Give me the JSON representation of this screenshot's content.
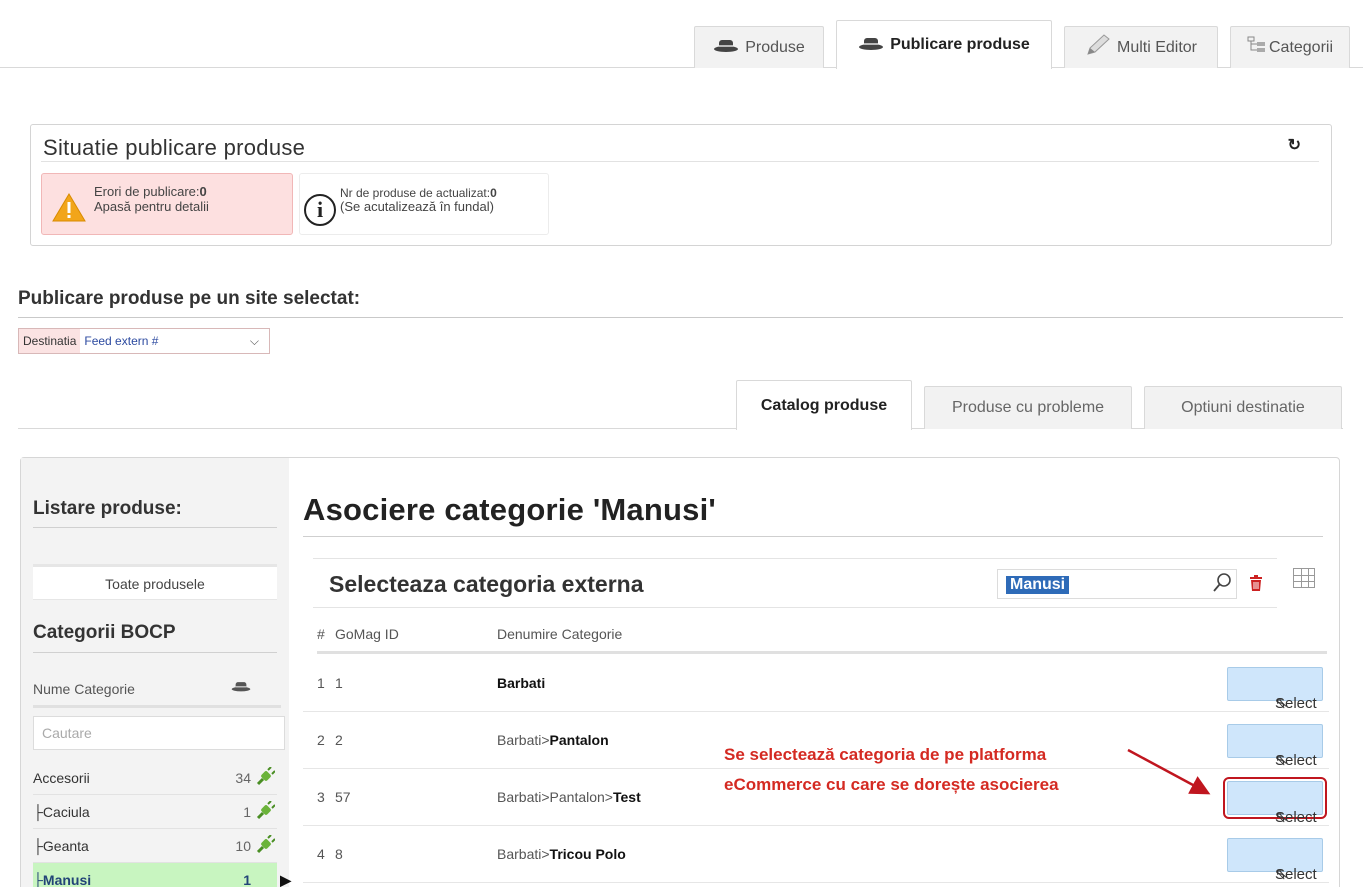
{
  "top_tabs": [
    {
      "label": "Produse",
      "icon": "hat-icon"
    },
    {
      "label": "Publicare produse",
      "icon": "hat-icon"
    },
    {
      "label": "Multi Editor",
      "icon": "pencil-icon"
    },
    {
      "label": "Categorii",
      "icon": "tree-icon"
    }
  ],
  "situatie": {
    "title": "Situatie publicare produse",
    "errors_label": "Erori de publicare:",
    "errors_count": "0",
    "errors_hint": "Apasă pentru detalii",
    "update_label": "Nr de produse de actualizat:",
    "update_count": "0",
    "update_hint": "(Se acutalizează în fundal)"
  },
  "publicare": {
    "title": "Publicare produse pe un site selectat:",
    "dest_label": "Destinatia",
    "dest_value": "Feed extern #"
  },
  "sec_tabs": [
    {
      "label": "Catalog produse"
    },
    {
      "label": "Produse cu probleme"
    },
    {
      "label": "Optiuni destinatie"
    }
  ],
  "sidebar": {
    "title": "Listare produse:",
    "all_products": "Toate produsele",
    "categories_title": "Categorii BOCP",
    "name_header": "Nume Categorie",
    "search_placeholder": "Cautare",
    "categories": [
      {
        "name": "Accesorii",
        "count": "34"
      },
      {
        "name": "├Caciula",
        "count": "1"
      },
      {
        "name": "├Geanta",
        "count": "10"
      },
      {
        "name": "├Manusi",
        "count": "1"
      }
    ]
  },
  "main": {
    "title": "Asociere categorie 'Manusi'",
    "select_title": "Selecteaza categoria externa",
    "search_value": "Manusi",
    "columns": [
      "#",
      "GoMag ID",
      "Denumire Categorie"
    ],
    "select_label": "Select",
    "rows": [
      {
        "num": "1",
        "id": "1",
        "prefix": "",
        "name": "Barbati"
      },
      {
        "num": "2",
        "id": "2",
        "prefix": "Barbati>",
        "name": "Pantalon"
      },
      {
        "num": "3",
        "id": "57",
        "prefix": "Barbati>Pantalon>",
        "name": "Test"
      },
      {
        "num": "4",
        "id": "8",
        "prefix": "Barbati>",
        "name": "Tricou Polo"
      }
    ]
  },
  "annotation": {
    "line1": "Se selectează categoria de pe platforma",
    "line2": "eCommerce cu care se dorește asocierea",
    "color": "#d42a22"
  }
}
